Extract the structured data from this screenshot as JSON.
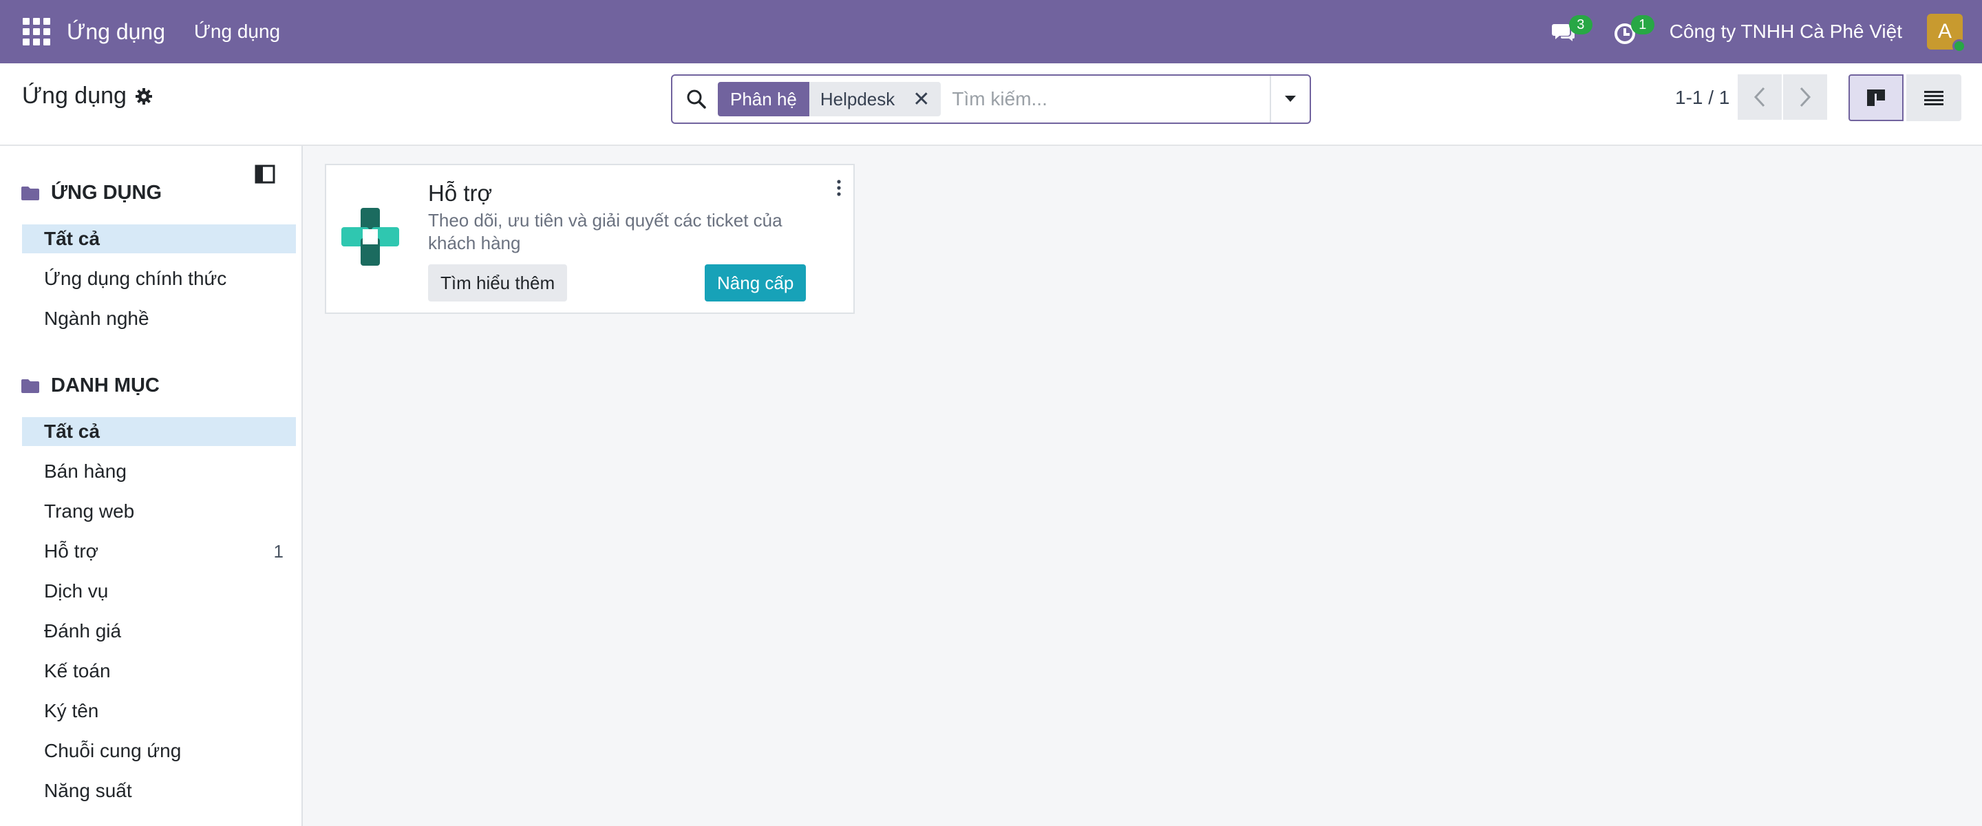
{
  "navbar": {
    "brand": "Ứng dụng",
    "menu_item": "Ứng dụng",
    "messages_count": "3",
    "activities_count": "1",
    "company": "Công ty TNHH Cà Phê Việt",
    "avatar_initial": "A",
    "bg_color": "#71639e"
  },
  "control_panel": {
    "title": "Ứng dụng",
    "search": {
      "facet_label": "Phân hệ",
      "facet_value": "Helpdesk",
      "placeholder": "Tìm kiếm..."
    },
    "pager": "1-1 / 1"
  },
  "sidebar": {
    "apps_section": {
      "title": "ỨNG DỤNG",
      "items": [
        {
          "label": "Tất cả"
        },
        {
          "label": "Ứng dụng chính thức"
        },
        {
          "label": "Ngành nghề"
        }
      ]
    },
    "category_section": {
      "title": "DANH MỤC",
      "items": [
        {
          "label": "Tất cả",
          "count": ""
        },
        {
          "label": "Bán hàng",
          "count": ""
        },
        {
          "label": "Trang web",
          "count": ""
        },
        {
          "label": "Hỗ trợ",
          "count": "1"
        },
        {
          "label": "Dịch vụ",
          "count": ""
        },
        {
          "label": "Đánh giá",
          "count": ""
        },
        {
          "label": "Kế toán",
          "count": ""
        },
        {
          "label": "Ký tên",
          "count": ""
        },
        {
          "label": "Chuỗi cung ứng",
          "count": ""
        },
        {
          "label": "Năng suất",
          "count": ""
        }
      ]
    }
  },
  "cards": [
    {
      "title": "Hỗ trợ",
      "description": "Theo dõi, ưu tiên và giải quyết các ticket của khách hàng",
      "learn_more_label": "Tìm hiểu thêm",
      "upgrade_label": "Nâng cấp",
      "icon": "helpdesk-icon"
    }
  ]
}
